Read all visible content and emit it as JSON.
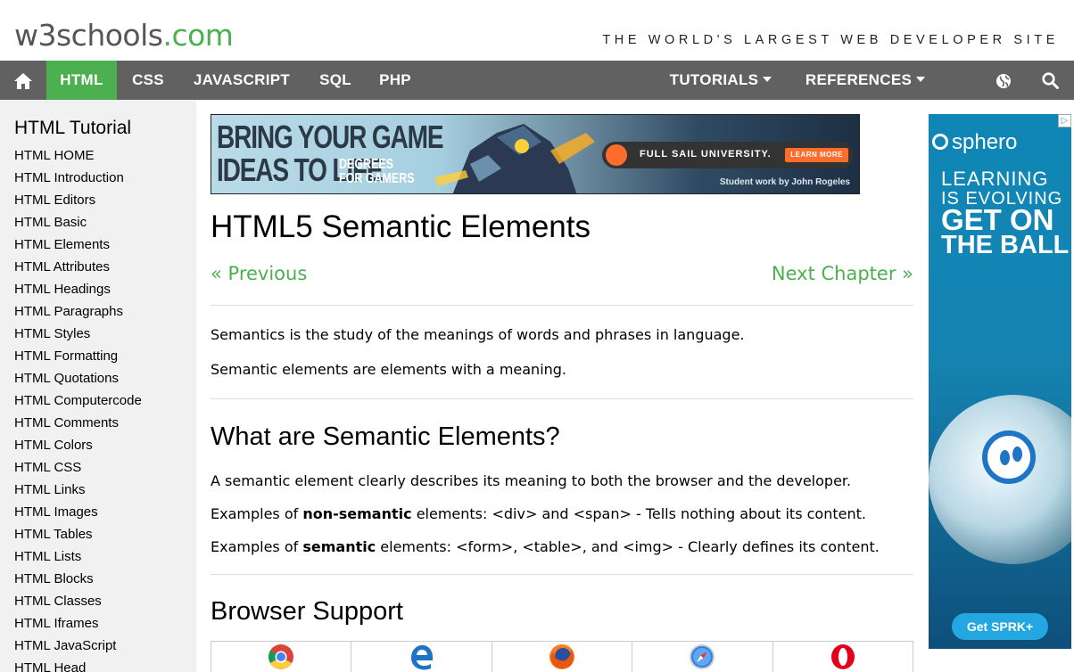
{
  "site": {
    "logo_main": "w3schools",
    "logo_ext": ".com",
    "tagline": "THE WORLD'S LARGEST WEB DEVELOPER SITE"
  },
  "nav": {
    "home_icon": "home-icon",
    "items": [
      {
        "label": "HTML",
        "active": true
      },
      {
        "label": "CSS",
        "active": false
      },
      {
        "label": "JAVASCRIPT",
        "active": false
      },
      {
        "label": "SQL",
        "active": false
      },
      {
        "label": "PHP",
        "active": false
      }
    ],
    "tutorials": "TUTORIALS",
    "references": "REFERENCES",
    "globe_icon": "globe-icon",
    "search_icon": "search-icon",
    "active_color": "#4CAF50",
    "bar_color": "#616161"
  },
  "sidebar": {
    "heading": "HTML Tutorial",
    "items": [
      "HTML HOME",
      "HTML Introduction",
      "HTML Editors",
      "HTML Basic",
      "HTML Elements",
      "HTML Attributes",
      "HTML Headings",
      "HTML Paragraphs",
      "HTML Styles",
      "HTML Formatting",
      "HTML Quotations",
      "HTML Computercode",
      "HTML Comments",
      "HTML Colors",
      "HTML CSS",
      "HTML Links",
      "HTML Images",
      "HTML Tables",
      "HTML Lists",
      "HTML Blocks",
      "HTML Classes",
      "HTML Iframes",
      "HTML JavaScript",
      "HTML Head"
    ]
  },
  "banner_ad": {
    "headline_1": "BRING YOUR GAME",
    "headline_2": "IDEAS TO LIFE",
    "sub_1": "DEGREES",
    "sub_2": "FOR GAMERS",
    "school": "FULL SAIL UNIVERSITY.",
    "learn_more": "LEARN MORE",
    "credit": "Student work by John Rogeles"
  },
  "main": {
    "title": "HTML5 Semantic Elements",
    "prev": "« Previous",
    "next": "Next Chapter »",
    "intro_1": "Semantics is the study of the meanings of words and phrases in language.",
    "intro_2": "Semantic elements are elements with a meaning.",
    "section_1": "What are Semantic Elements?",
    "desc": "A semantic element clearly describes its meaning to both the browser and the developer.",
    "ex1_prefix": "Examples of ",
    "ex1_bold": "non-semantic",
    "ex1_suffix": " elements: <div> and <span> - Tells nothing about its content.",
    "ex2_prefix": "Examples of ",
    "ex2_bold": "semantic",
    "ex2_suffix": " elements: <form>, <table>, and <img> - Clearly defines its content.",
    "section_2": "Browser Support",
    "browsers": [
      "chrome-icon",
      "edge-icon",
      "firefox-icon",
      "safari-icon",
      "opera-icon"
    ]
  },
  "side_ad": {
    "brand": "sphero",
    "line_1": "LEARNING",
    "line_2": "IS EVOLVING",
    "line_3": "GET ON",
    "line_4": "THE BALL",
    "cta": "Get SPRK+",
    "adchoices": "▷"
  }
}
